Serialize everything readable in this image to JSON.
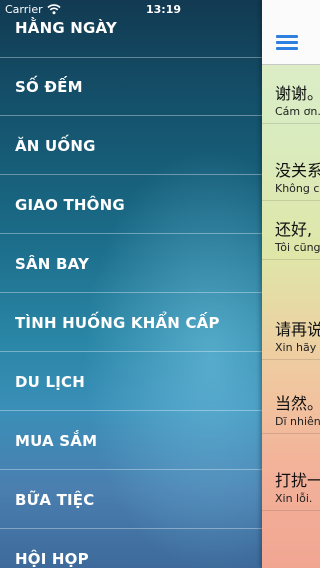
{
  "status_bar": {
    "carrier": "Carrier",
    "time": "13:19"
  },
  "menu": {
    "items": [
      {
        "label": "HẰNG NGÀY"
      },
      {
        "label": "SỐ ĐẾM"
      },
      {
        "label": "ĂN UỐNG"
      },
      {
        "label": "GIAO THÔNG"
      },
      {
        "label": "SÂN BAY"
      },
      {
        "label": "TÌNH HUỐNG KHẨN CẤP"
      },
      {
        "label": "DU LỊCH"
      },
      {
        "label": "MUA SẮM"
      },
      {
        "label": "BỮA TIỆC"
      },
      {
        "label": "HỘI HỌP"
      }
    ]
  },
  "content": {
    "menu_icon": "hamburger-icon",
    "accent_color": "#2d7fe0",
    "phrases": [
      {
        "chinese": "谢谢。",
        "vietnamese": "Cám ơn."
      },
      {
        "chinese": "没关系",
        "vietnamese": "Không c"
      },
      {
        "chinese": "还好,",
        "vietnamese": "Tôi cũng"
      },
      {
        "chinese": "请再说",
        "vietnamese": "Xin hãy"
      },
      {
        "chinese": "当然。",
        "vietnamese": "Dĩ nhiên"
      },
      {
        "chinese": "打扰一",
        "vietnamese": "Xin lỗi."
      }
    ]
  }
}
